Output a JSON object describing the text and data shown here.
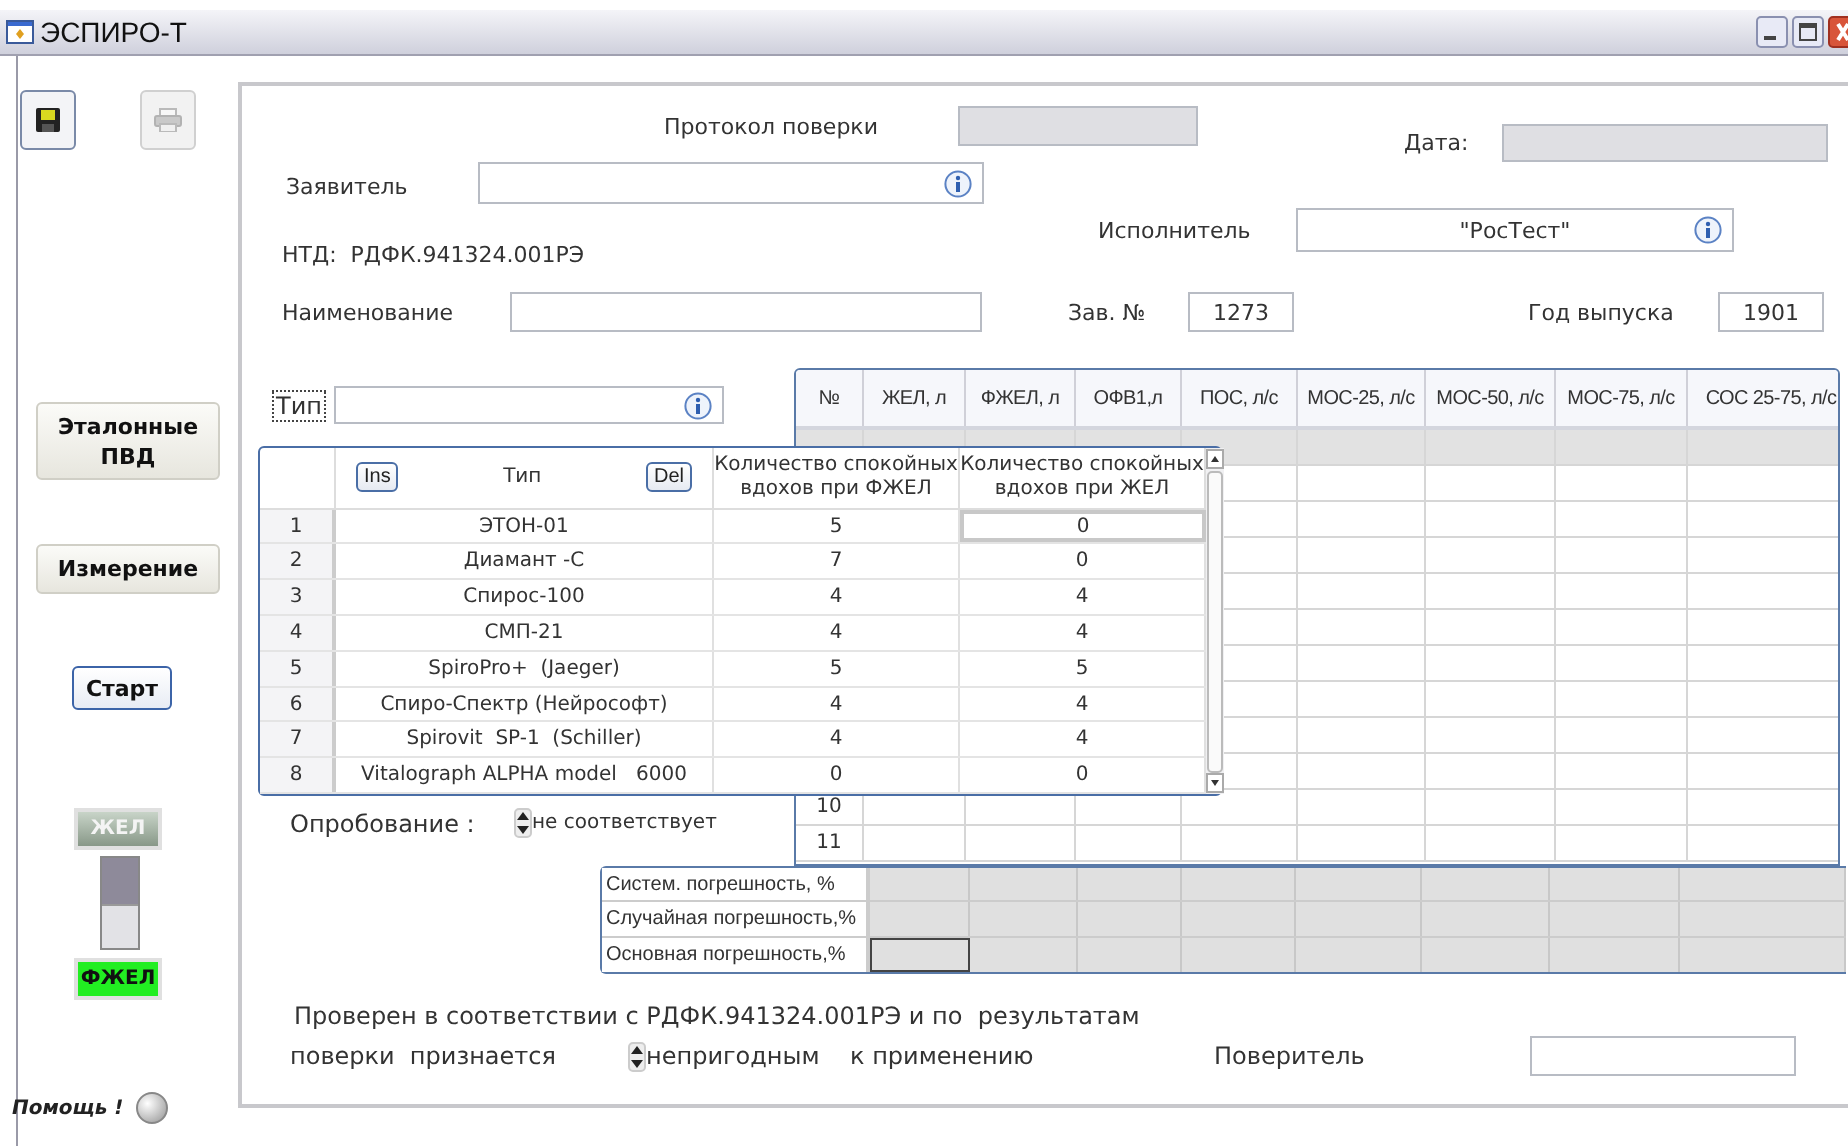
{
  "window": {
    "title": "ЭСПИРО-Т"
  },
  "toolbar": [
    {
      "kind": "save",
      "disabled": false
    },
    {
      "kind": "print",
      "disabled": true
    }
  ],
  "side_buttons": [
    {
      "label": "Эталонные ПВД",
      "kind": "plain"
    },
    {
      "label": "Измерение",
      "kind": "plain"
    },
    {
      "label": "Старт",
      "kind": "default"
    }
  ],
  "mode_switch": {
    "level": 0.5
  },
  "modes": [
    {
      "label": "ЖЕЛ",
      "on": false
    },
    {
      "label": "ФЖЕЛ",
      "on": true
    }
  ],
  "help": {
    "label": "Помощь !"
  },
  "form": {
    "protocol": {
      "label": "Протокол поверки"
    },
    "date": {
      "label": "Дата:"
    },
    "applicant": {
      "label": "Заявитель"
    },
    "executor": {
      "label": "Исполнитель",
      "value": "\"РосТест\""
    },
    "ntd": "НТД:  РДФК.941324.001РЭ",
    "name": {
      "label": "Наименование"
    },
    "serial": {
      "label": "Зав. №",
      "value": "1273"
    },
    "year": {
      "label": "Год выпуска",
      "value": "1901"
    },
    "type": {
      "label": "Тип"
    }
  },
  "measurements": {
    "columns": [
      "№",
      "ЖЕЛ, л",
      "ФЖЕЛ, л",
      "ОФВ1,л",
      "ПОС, л/с",
      "МОС-25, л/с",
      "МОС-50, л/с",
      "МОС-75, л/с",
      "СОС 25-75, л/с"
    ],
    "rows": [
      {
        "shaded": true
      },
      {
        "shaded": false
      },
      {
        "shaded": false
      },
      {
        "shaded": false
      },
      {
        "shaded": false
      },
      {
        "shaded": false
      },
      {
        "shaded": false
      },
      {
        "shaded": false
      },
      {
        "shaded": false
      },
      {
        "shaded": false
      },
      {
        "number": "10",
        "shaded": false
      },
      {
        "number": "11",
        "shaded": false
      }
    ]
  },
  "type_list": {
    "insert_button": "Ins",
    "delete_button": "Del",
    "columns": [
      "Тип",
      "Количество спокойных вдохов при ФЖЕЛ",
      "Количество спокойных вдохов при ЖЕЛ"
    ],
    "rows": [
      {
        "number": "1",
        "type": "ЭТОН-01",
        "fvc_breaths": "5",
        "vc_breaths": "0",
        "selected": true
      },
      {
        "number": "2",
        "type": "Диамант -С",
        "fvc_breaths": "7",
        "vc_breaths": "0",
        "selected": false
      },
      {
        "number": "3",
        "type": "Спирос-100",
        "fvc_breaths": "4",
        "vc_breaths": "4",
        "selected": false
      },
      {
        "number": "4",
        "type": "СМП-21",
        "fvc_breaths": "4",
        "vc_breaths": "4",
        "selected": false
      },
      {
        "number": "5",
        "type": "SpiroPro+  (Jaeger)",
        "fvc_breaths": "5",
        "vc_breaths": "5",
        "selected": false
      },
      {
        "number": "6",
        "type": "Спиро-Спектр (Нейрософт)",
        "fvc_breaths": "4",
        "vc_breaths": "4",
        "selected": false
      },
      {
        "number": "7",
        "type": "Spirovit  SP-1  (Schiller)",
        "fvc_breaths": "4",
        "vc_breaths": "4",
        "selected": false
      },
      {
        "number": "8",
        "type": "Vitalograph ALPHA model   6000",
        "fvc_breaths": "0",
        "vc_breaths": "0",
        "selected": false
      }
    ]
  },
  "trial": {
    "label": "Опробование :",
    "value": "не соответствует"
  },
  "errors": {
    "rows": [
      {
        "label": "Систем. погрешность, %",
        "selected": false
      },
      {
        "label": "Случайная погрешность,%",
        "selected": false
      },
      {
        "label": "Основная погрешность,%",
        "selected": true
      }
    ]
  },
  "conclusion": {
    "sentence": "Проверен в соответствии с РДФК.941324.001РЭ и по  результатам",
    "prefix": "поверки  признается",
    "verdict": "непригодным",
    "suffix": "к применению"
  },
  "verifier": {
    "label": "Поверитель"
  }
}
